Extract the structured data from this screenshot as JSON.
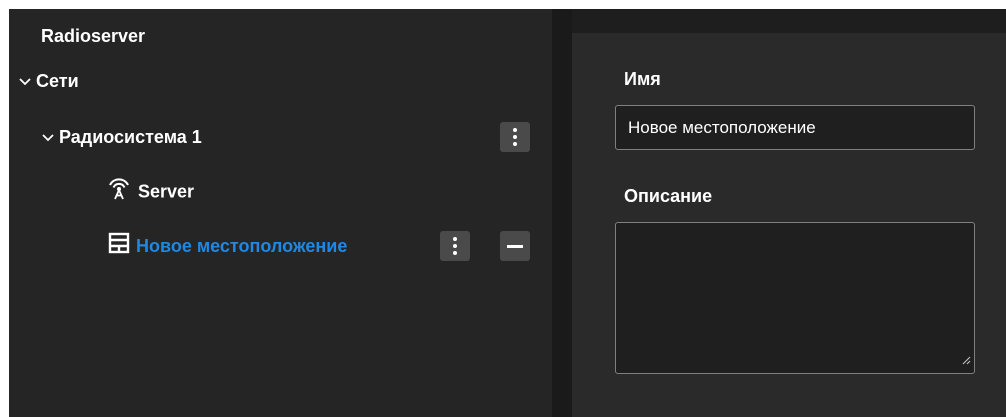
{
  "tree": {
    "root_label": "Radioserver",
    "networks_label": "Сети",
    "radiosystem_label": "Радиосистема 1",
    "server_label": "Server",
    "location_label": "Новое местоположение",
    "selected_color": "#1e88e5"
  },
  "details": {
    "name_label": "Имя",
    "name_value": "Новое местоположение",
    "description_label": "Описание",
    "description_value": ""
  }
}
